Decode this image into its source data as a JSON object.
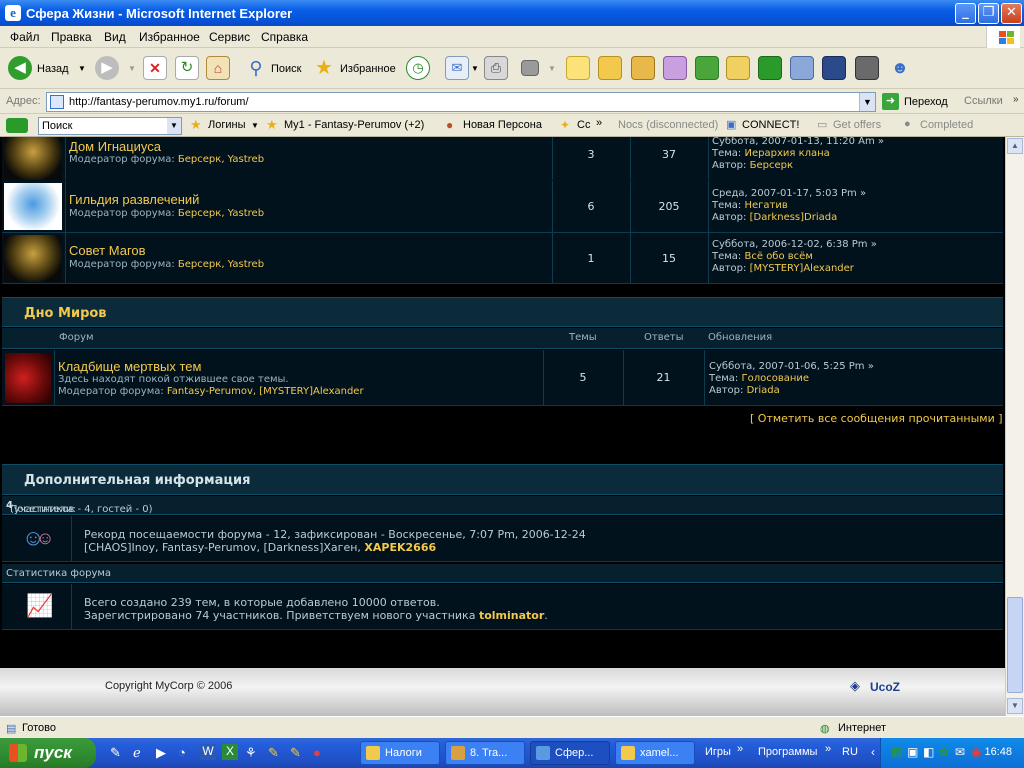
{
  "window": {
    "title": "Сфера Жизни - Microsoft Internet Explorer"
  },
  "menu": [
    "Файл",
    "Правка",
    "Вид",
    "Избранное",
    "Сервис",
    "Справка"
  ],
  "toolbar": {
    "back": "Назад",
    "search": "Поиск",
    "favorites": "Избранное"
  },
  "address": {
    "label": "Адрес:",
    "url": "http://fantasy-perumov.my1.ru/forum/",
    "go": "Переход",
    "links": "Ссылки"
  },
  "toolbar2": {
    "search_placeholder": "Поиск",
    "logins": "Логины",
    "my1": "My1 - Fantasy-Perumov (+2)",
    "new_persona": "Новая Персона",
    "cc": "Cc",
    "nocs": "Nocs (disconnected)",
    "connect": "CONNECT!",
    "get_offers": "Get offers",
    "completed": "Completed"
  },
  "forums_top": [
    {
      "title": "Дом Игнациуса",
      "moderator_label": "Модератор форума:",
      "moderators": "Берсерк, Yastreb",
      "topics": "3",
      "replies": "37",
      "last_date": "Суббота, 2007-01-13, 11:20 Am",
      "topic_label": "Тема:",
      "last_topic": "Иерархия клана",
      "author_label": "Автор:",
      "last_author": "Берсерк"
    },
    {
      "title": "Гильдия развлечений",
      "moderator_label": "Модератор форума:",
      "moderators": "Берсерк, Yastreb",
      "topics": "6",
      "replies": "205",
      "last_date": "Среда, 2007-01-17, 5:03 Pm",
      "topic_label": "Тема:",
      "last_topic": "Негатив",
      "author_label": "Автор:",
      "last_author": "[Darkness]Driada"
    },
    {
      "title": "Совет Магов",
      "moderator_label": "Модератор форума:",
      "moderators": "Берсерк, Yastreb",
      "topics": "1",
      "replies": "15",
      "last_date": "Суббота, 2006-12-02, 6:38 Pm",
      "topic_label": "Тема:",
      "last_topic": "Всё обо всём",
      "author_label": "Автор:",
      "last_author": "[MYSTERY]Alexander"
    }
  ],
  "section_bottom": {
    "title": "Дно Миров",
    "columns": {
      "forum": "Форум",
      "topics": "Темы",
      "replies": "Ответы",
      "updates": "Обновления"
    },
    "forum": {
      "title": "Кладбище мертвых тем",
      "desc": "Здесь находят покой отжившее свое темы.",
      "moderator_label": "Модератор форума:",
      "moderators": "Fantasy-Perumov, [MYSTERY]Alexander",
      "topics": "5",
      "replies": "21",
      "last_date": "Суббота, 2007-01-06, 5:25 Pm",
      "topic_label": "Тема:",
      "last_topic": "Голосование",
      "author_label": "Автор:",
      "last_author": "Driada"
    }
  },
  "mark_read": "Отметить все сообщения прочитанными",
  "info": {
    "title": "Дополнительная информация",
    "visitors_label": "Посетители:",
    "visitors_count": "4",
    "visitors_detail": "(участников - 4, гостей - 0)",
    "record_text": "Рекорд посещаемости форума - 12, зафиксирован - Воскресенье, 7:07 Pm, 2006-12-24",
    "online_users": "[CHAOS]Inoy, Fantasy-Perumov, [Darkness]Хаген,",
    "online_highlight": "XAPEK2666",
    "stats_title": "Статистика форума",
    "stats_line1": "Всего создано 239 тем, в которые добавлено 10000 ответов.",
    "stats_line2_pre": "Зарегистрировано 74 участников. Приветствуем нового участника",
    "new_member": "tolminator",
    "stats_line2_post": "."
  },
  "footer": {
    "copyright": "Copyright MyCorp © 2006",
    "ucoz": "UcoZ"
  },
  "status": {
    "left": "Готово",
    "zone": "Интернет"
  },
  "taskbar": {
    "start": "пуск",
    "buttons": [
      "Налоги",
      "8. Tra...",
      "Сфер...",
      "xamel..."
    ],
    "labels": [
      "Игры",
      "Программы"
    ],
    "lang": "RU",
    "clock": "16:48"
  },
  "colors": {
    "accent": "#f2c94c",
    "bg": "#02121d",
    "border": "#0c3b4f"
  }
}
